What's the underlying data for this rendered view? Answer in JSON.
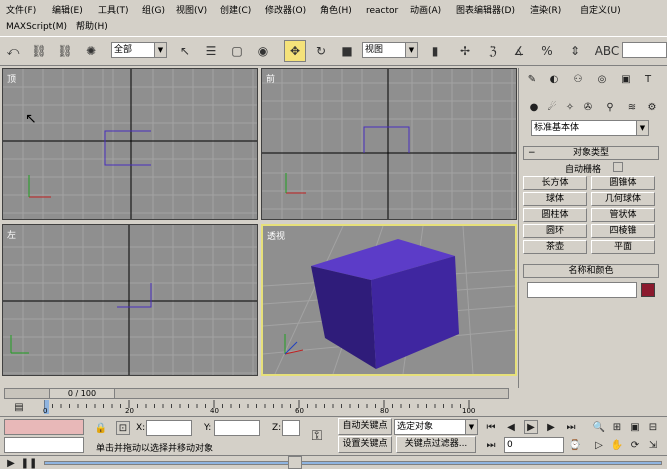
{
  "menu": [
    "文件(F)",
    "编辑(E)",
    "工具(T)",
    "组(G)",
    "视图(V)",
    "创建(C)",
    "修改器(O)",
    "角色(H)",
    "reactor",
    "动画(A)",
    "图表编辑器(D)",
    "渲染(R)",
    "自定义(U)",
    "MAXScript(M)",
    "帮助(H)"
  ],
  "toolbar": {
    "selection_filter": "全部",
    "coord_system": "视图"
  },
  "viewports": [
    {
      "label": "顶"
    },
    {
      "label": "前"
    },
    {
      "label": "左"
    },
    {
      "label": "透视"
    }
  ],
  "cmd_panel": {
    "category": "标准基本体",
    "object_type_title": "对象类型",
    "auto_grid": "自动栅格",
    "buttons": [
      "长方体",
      "圆锥体",
      "球体",
      "几何球体",
      "圆柱体",
      "管状体",
      "圆环",
      "四棱锥",
      "茶壶",
      "平面"
    ],
    "name_color_title": "名称和颜色",
    "object_color": "#8b1a2e"
  },
  "timeline": {
    "frame_display": "0 / 100",
    "ticks": [
      "0",
      "20",
      "40",
      "60",
      "80",
      "100"
    ]
  },
  "status": {
    "x_label": "X:",
    "y_label": "Y:",
    "z_label": "Z:",
    "auto_key": "自动关键点",
    "set_key": "设置关键点",
    "key_mode": "选定对象",
    "key_filter": "关键点过滤器...",
    "prompt": "单击并拖动以选择并移动对象",
    "frame_field": "0"
  }
}
